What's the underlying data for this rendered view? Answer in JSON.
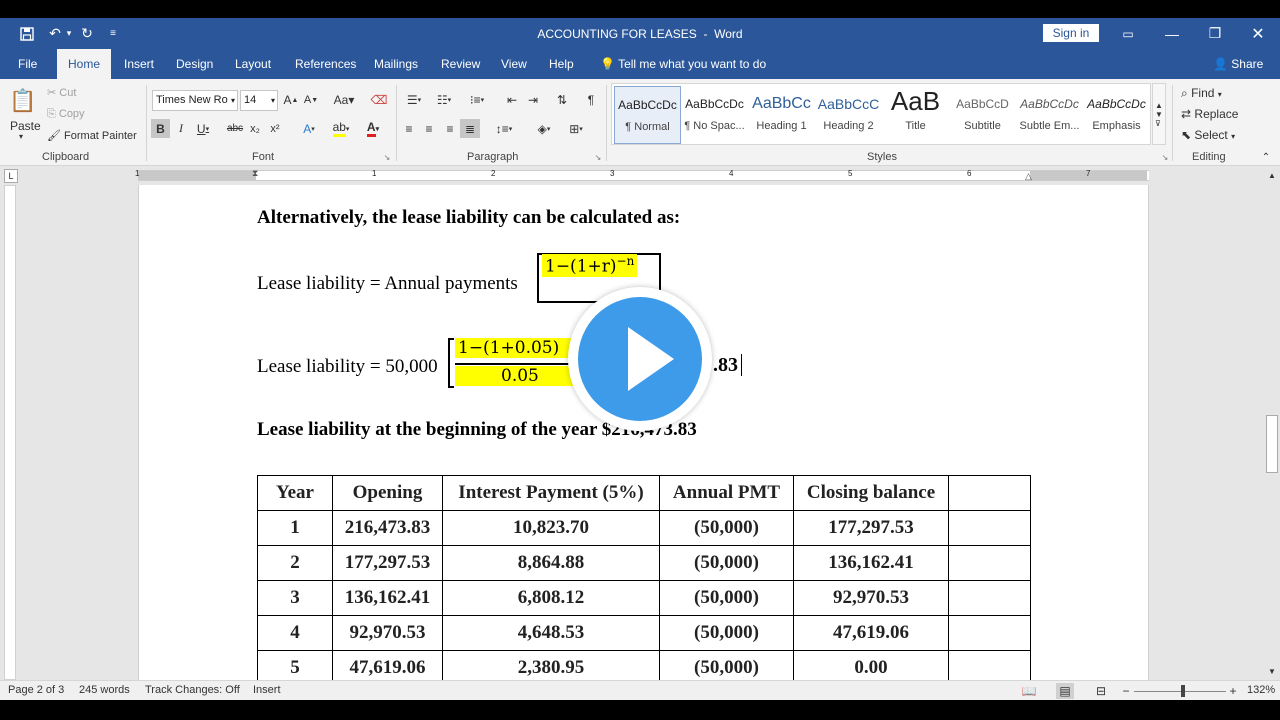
{
  "window": {
    "title": "ACCOUNTING FOR LEASES",
    "title_sep": "-",
    "app": "Word",
    "sign_in": "Sign in"
  },
  "tabs": {
    "file": "File",
    "home": "Home",
    "insert": "Insert",
    "design": "Design",
    "layout": "Layout",
    "references": "References",
    "mailings": "Mailings",
    "review": "Review",
    "view": "View",
    "help": "Help",
    "tell_me": "Tell me what you want to do",
    "share": "Share"
  },
  "ribbon": {
    "clipboard": {
      "paste": "Paste",
      "cut": "Cut",
      "copy": "Copy",
      "format_painter": "Format Painter",
      "label": "Clipboard"
    },
    "font": {
      "name": "Times New Ro",
      "size": "14",
      "label": "Font",
      "case": "Aa"
    },
    "paragraph": {
      "label": "Paragraph"
    },
    "styles": {
      "label": "Styles",
      "items": [
        {
          "preview": "AaBbCcDc",
          "name": "¶ Normal"
        },
        {
          "preview": "AaBbCcDc",
          "name": "¶ No Spac..."
        },
        {
          "preview": "AaBbCc",
          "name": "Heading 1"
        },
        {
          "preview": "AaBbCcC",
          "name": "Heading 2"
        },
        {
          "preview": "AaB",
          "name": "Title"
        },
        {
          "preview": "AaBbCcD",
          "name": "Subtitle"
        },
        {
          "preview": "AaBbCcDc",
          "name": "Subtle Em..."
        },
        {
          "preview": "AaBbCcDc",
          "name": "Emphasis"
        }
      ]
    },
    "editing": {
      "find": "Find",
      "replace": "Replace",
      "select": "Select",
      "label": "Editing"
    }
  },
  "ruler": {
    "numbers": [
      "1",
      "1",
      "2",
      "3",
      "4",
      "5",
      "6",
      "7"
    ]
  },
  "document": {
    "heading": "Alternatively, the lease liability can be calculated as:",
    "formula1_lhs": "Lease liability = Annual payments",
    "formula1_num": "1−(1+r)",
    "formula1_exp": "−n",
    "formula2_lhs": "Lease liability = 50,000",
    "formula2_num": "1−(1+0.05)",
    "formula2_den": "0.05",
    "formula2_result": ".83",
    "summary": "Lease liability at the beginning of the year $216,473.83",
    "table": {
      "headers": [
        "Year",
        "Opening",
        "Interest Payment (5%)",
        "Annual PMT",
        "Closing balance",
        ""
      ],
      "rows": [
        [
          "1",
          "216,473.83",
          "10,823.70",
          "(50,000)",
          "177,297.53",
          ""
        ],
        [
          "2",
          "177,297.53",
          "8,864.88",
          "(50,000)",
          "136,162.41",
          ""
        ],
        [
          "3",
          "136,162.41",
          "6,808.12",
          "(50,000)",
          "92,970.53",
          ""
        ],
        [
          "4",
          "92,970.53",
          "4,648.53",
          "(50,000)",
          "47,619.06",
          ""
        ],
        [
          "5",
          "47,619.06",
          "2,380.95",
          "(50,000)",
          "0.00",
          ""
        ]
      ]
    }
  },
  "status": {
    "page": "Page 2 of 3",
    "words": "245 words",
    "track": "Track Changes: Off",
    "mode": "Insert",
    "zoom": "132%"
  },
  "colors": {
    "brand": "#2b579a",
    "highlight": "#ffff00",
    "play": "#3d9be9"
  }
}
